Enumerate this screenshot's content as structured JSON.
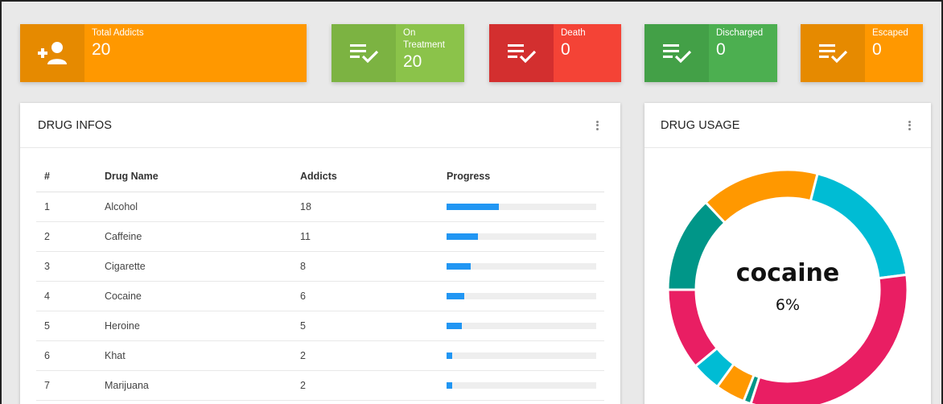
{
  "stats": [
    {
      "label": "Total Addicts",
      "value": "20",
      "icon": "add-user-icon"
    },
    {
      "label": "On Treatment",
      "value": "20",
      "icon": "checklist-icon"
    },
    {
      "label": "Death",
      "value": "0",
      "icon": "checklist-icon"
    },
    {
      "label": "Discharged",
      "value": "0",
      "icon": "checklist-icon"
    },
    {
      "label": "Escaped",
      "value": "0",
      "icon": "checklist-icon"
    }
  ],
  "drug_infos": {
    "title": "DRUG INFOS",
    "columns": [
      "#",
      "Drug Name",
      "Addicts",
      "Progress"
    ],
    "rows": [
      {
        "num": "1",
        "name": "Alcohol",
        "addicts": "18",
        "progress": 0.35
      },
      {
        "num": "2",
        "name": "Caffeine",
        "addicts": "11",
        "progress": 0.21
      },
      {
        "num": "3",
        "name": "Cigarette",
        "addicts": "8",
        "progress": 0.16
      },
      {
        "num": "4",
        "name": "Cocaine",
        "addicts": "6",
        "progress": 0.12
      },
      {
        "num": "5",
        "name": "Heroine",
        "addicts": "5",
        "progress": 0.1
      },
      {
        "num": "6",
        "name": "Khat",
        "addicts": "2",
        "progress": 0.04
      },
      {
        "num": "7",
        "name": "Marijuana",
        "addicts": "2",
        "progress": 0.04
      }
    ]
  },
  "drug_usage": {
    "title": "DRUG USAGE",
    "center_label": "cocaine",
    "center_value": "6%"
  },
  "chart_data": {
    "type": "pie",
    "series": [
      {
        "name": "",
        "values": [
          19,
          32,
          1,
          4,
          4,
          11,
          13,
          16
        ],
        "colors": [
          "#00bcd4",
          "#e91e63",
          "#009688",
          "#ff9800",
          "#00bcd4",
          "#e91e63",
          "#009688",
          "#ff9800"
        ]
      }
    ]
  },
  "colors": {
    "progress": "#2196f3",
    "orange": "#ff9800",
    "green": "#8bc34a",
    "red": "#f44336",
    "dark_green": "#4caf50"
  }
}
